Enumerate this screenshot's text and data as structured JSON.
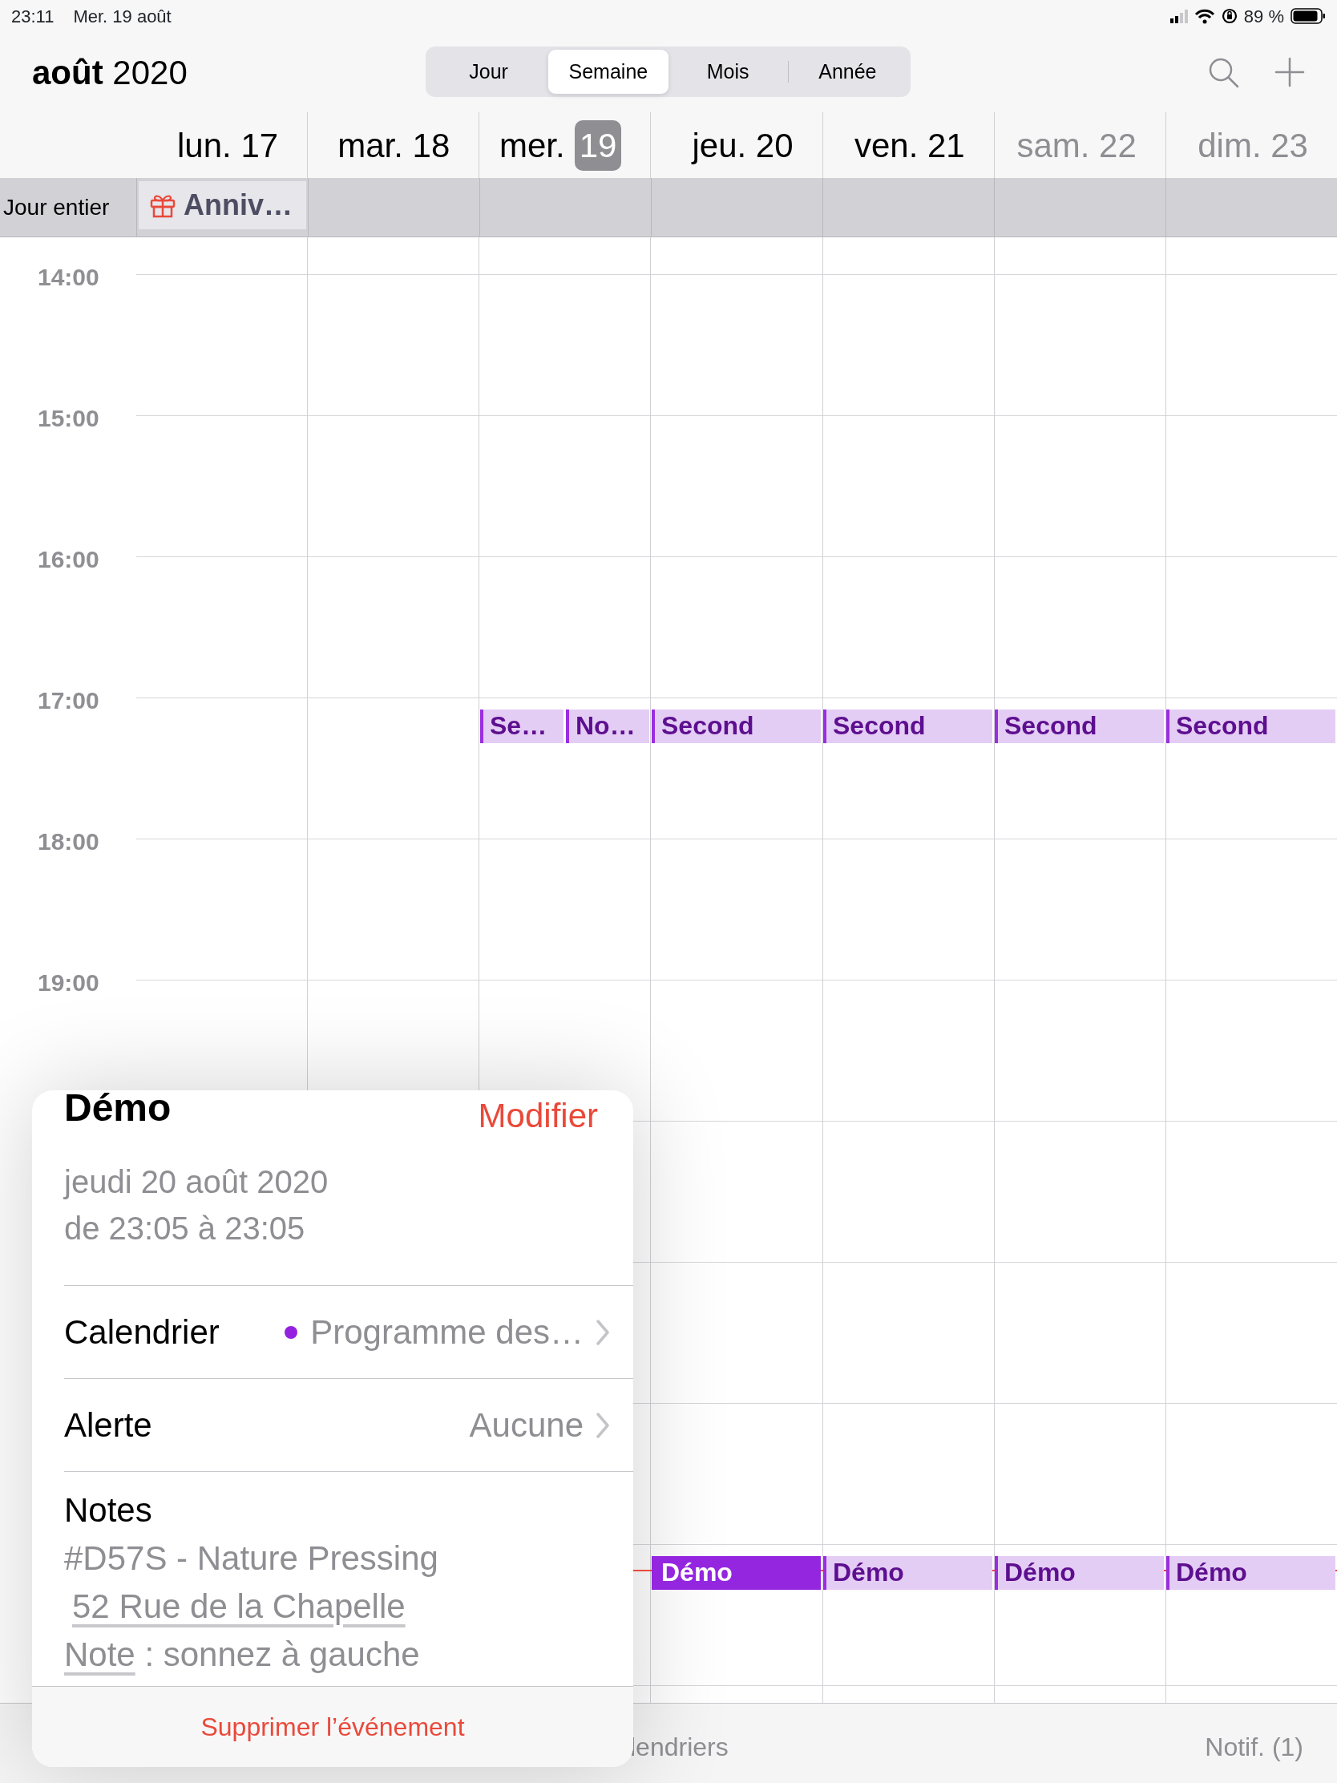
{
  "status_bar": {
    "time": "23:11",
    "date": "Mer. 19 août",
    "battery": "89 %"
  },
  "header": {
    "title": "**août** 2020"
  },
  "view_tabs": [
    {
      "label": "Jour",
      "selected": false
    },
    {
      "label": "Semaine",
      "selected": true
    },
    {
      "label": "Mois",
      "selected": false
    },
    {
      "label": "Année",
      "selected": false
    }
  ],
  "all_day_label": "Jour entier",
  "days": [
    {
      "weekday": "lun.",
      "date": "17",
      "today": false,
      "weekend": false,
      "all_day": [
        {
          "title": "Anniv…"
        }
      ]
    },
    {
      "weekday": "mar.",
      "date": "18",
      "today": false,
      "weekend": false
    },
    {
      "weekday": "mer.",
      "date": "19",
      "today": true,
      "weekend": false,
      "events": [
        {
          "kind": "afternoon",
          "title": "Se…",
          "selected": false
        },
        {
          "kind": "afternoon",
          "title": "No…",
          "selected": false
        }
      ]
    },
    {
      "weekday": "jeu.",
      "date": "20",
      "today": false,
      "weekend": false,
      "events": [
        {
          "kind": "afternoon",
          "title": "Second",
          "selected": false
        },
        {
          "kind": "night",
          "title": "Démo",
          "selected": true
        }
      ]
    },
    {
      "weekday": "ven.",
      "date": "21",
      "today": false,
      "weekend": false,
      "events": [
        {
          "kind": "afternoon",
          "title": "Second",
          "selected": false
        },
        {
          "kind": "night",
          "title": "Démo",
          "selected": false
        }
      ]
    },
    {
      "weekday": "sam.",
      "date": "22",
      "today": false,
      "weekend": true,
      "events": [
        {
          "kind": "afternoon",
          "title": "Second",
          "selected": false
        },
        {
          "kind": "night",
          "title": "Démo",
          "selected": false
        }
      ]
    },
    {
      "weekday": "dim.",
      "date": "23",
      "today": false,
      "weekend": true,
      "events": [
        {
          "kind": "afternoon",
          "title": "Second",
          "selected": false
        },
        {
          "kind": "night",
          "title": "Démo",
          "selected": false
        }
      ]
    }
  ],
  "hours": [
    "14:00",
    "15:00",
    "16:00",
    "17:00",
    "18:00",
    "19:00"
  ],
  "popover": {
    "title": "Démo",
    "edit": "Modifier",
    "date_lines": [
      "jeudi 20 août 2020",
      "de 23:05 à 23:05"
    ],
    "rows": [
      {
        "label": "Calendrier",
        "value": "Programme des…",
        "color": "#9421e0"
      },
      {
        "label": "Alerte",
        "value": "Aucune"
      }
    ],
    "notes": {
      "label": "Notes",
      "lines": [
        [
          {
            "text": "#D57S - Nature Pressing",
            "link": false
          }
        ],
        [
          {
            "text": "52 Rue de la Chapelle",
            "link": true
          }
        ],
        [
          {
            "text": "Note",
            "link": true
          },
          {
            "text": " : sonnez à gauche",
            "link": false
          }
        ]
      ]
    },
    "delete": "Supprimer l’événement"
  },
  "bottom_bar": {
    "calendars": "lendriers",
    "notifications": "Notif. (1)"
  }
}
